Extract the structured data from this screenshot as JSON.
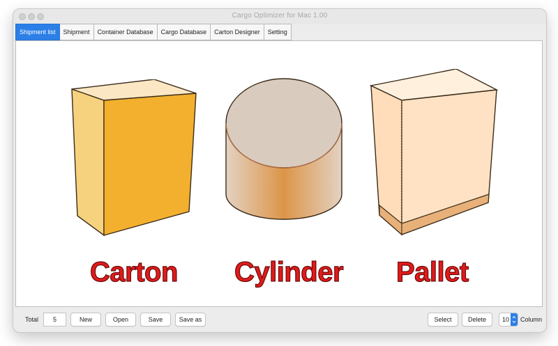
{
  "window": {
    "title": "Cargo Optimizer for Mac 1.00"
  },
  "tabs": [
    {
      "label": "Shipment list",
      "active": true
    },
    {
      "label": "Shipment"
    },
    {
      "label": "Container Database"
    },
    {
      "label": "Cargo Database"
    },
    {
      "label": "Carton Designer"
    },
    {
      "label": "Setting"
    }
  ],
  "main": {
    "shapes": [
      {
        "label": "Carton",
        "icon": "carton-box-icon"
      },
      {
        "label": "Cylinder",
        "icon": "cylinder-icon"
      },
      {
        "label": "Pallet",
        "icon": "pallet-box-icon"
      }
    ]
  },
  "footer": {
    "total_label": "Total",
    "total_value": "5",
    "new_label": "New",
    "open_label": "Open",
    "save_label": "Save",
    "save_as_label": "Save as",
    "select_label": "Select",
    "delete_label": "Delete",
    "columns_value": "10",
    "column_label": "Column"
  },
  "colors": {
    "accent": "#2b7fe6",
    "carton_front": "#f2b02e",
    "carton_side": "#f7d27e",
    "carton_top": "#fbe7c4",
    "cylinder_top": "#dacbbf",
    "cylinder_body": "#dc9548",
    "pallet_box": "#ffddba",
    "pallet_base": "#e8b17a",
    "label_red": "#e11b1b"
  }
}
